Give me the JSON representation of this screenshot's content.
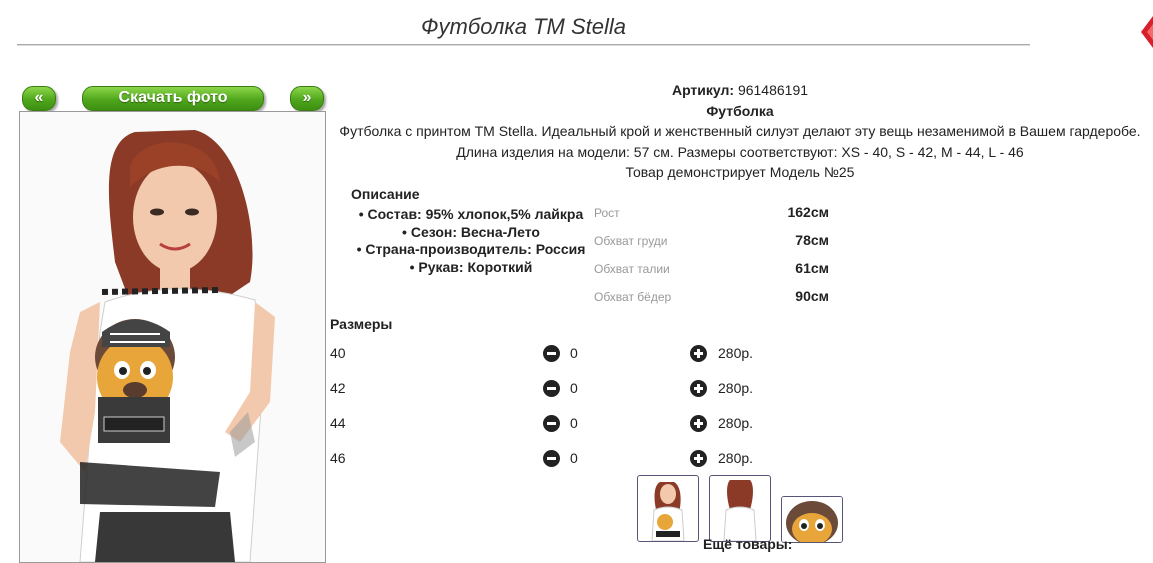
{
  "header": {
    "title": "Футболка TM Stella"
  },
  "gallery": {
    "prev_label": "«",
    "download_label": "Скачать фото",
    "next_label": "»"
  },
  "product": {
    "article_label": "Артикул:",
    "article_value": "961486191",
    "type": "Футболка",
    "description": "Футболка с принтом TM Stella. Идеальный крой и женственный силуэт делают эту вещь незаменимой в Вашем гардеробе.",
    "length_info": "Длина изделия на модели: 57 см. Размеры соответствуют: XS - 40, S - 42, M - 44, L - 46",
    "model_info": "Товар демонстрирует Модель №25"
  },
  "details": {
    "title": "Описание",
    "items": [
      "Состав: 95% хлопок,5% лайкра",
      "Сезон: Весна-Лето",
      "Страна-производитель: Россия",
      "Рукав: Короткий"
    ]
  },
  "measurements": [
    {
      "label": "Рост",
      "value": "162см"
    },
    {
      "label": "Обхват груди",
      "value": "78см"
    },
    {
      "label": "Обхват талии",
      "value": "61см"
    },
    {
      "label": "Обхват бёдер",
      "value": "90см"
    }
  ],
  "sizes": {
    "title": "Размеры",
    "rows": [
      {
        "size": "40",
        "qty": "0",
        "price": "280р."
      },
      {
        "size": "42",
        "qty": "0",
        "price": "280р."
      },
      {
        "size": "44",
        "qty": "0",
        "price": "280р."
      },
      {
        "size": "46",
        "qty": "0",
        "price": "280р."
      }
    ]
  },
  "more_label": "Ещё товары:",
  "colors": {
    "button_green": "#4fa71c",
    "close_red": "#d8202a",
    "photo_character": "#6b4a3a"
  },
  "icons": [
    "close-icon",
    "minus-icon",
    "plus-icon"
  ]
}
